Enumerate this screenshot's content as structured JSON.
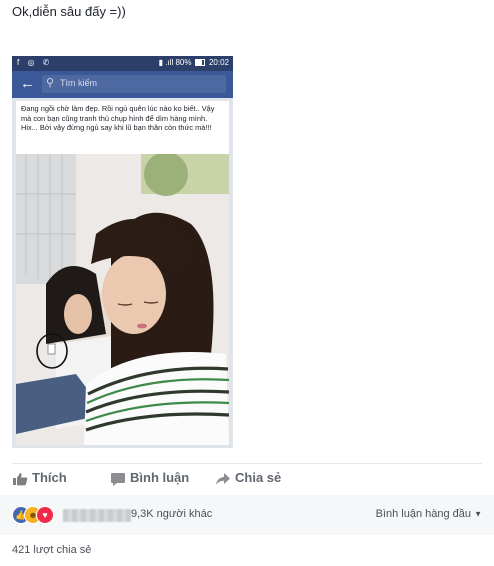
{
  "caption": "Ok,diễn sâu đấy =))",
  "phone": {
    "status_icons": "f ◎ ✆",
    "signal": "▮ .ıll",
    "battery": "80%",
    "time": "20:02",
    "search_placeholder": "Tìm kiếm",
    "post_text": "Đang ngồi chờ làm đẹp. Rồi ngủ quên lúc nào ko biết.. Vậy mà con bạn cũng tranh thủ chụp hình để dìm hàng mình. Hix... Bởi vậy đừng ngủ say khi lũ bạn thân còn thức mà!!!"
  },
  "actions": {
    "like": "Thích",
    "comment": "Bình luận",
    "share": "Chia sẻ"
  },
  "reactions": {
    "others": "9,3K người khác",
    "sort": "Bình luận hàng đầu"
  },
  "shares": "421 lượt chia sẻ",
  "colors": {
    "fb_blue": "#3b5998",
    "like_blue": "#4267b2",
    "love_red": "#f0284a",
    "haha_yellow": "#f7b125"
  }
}
